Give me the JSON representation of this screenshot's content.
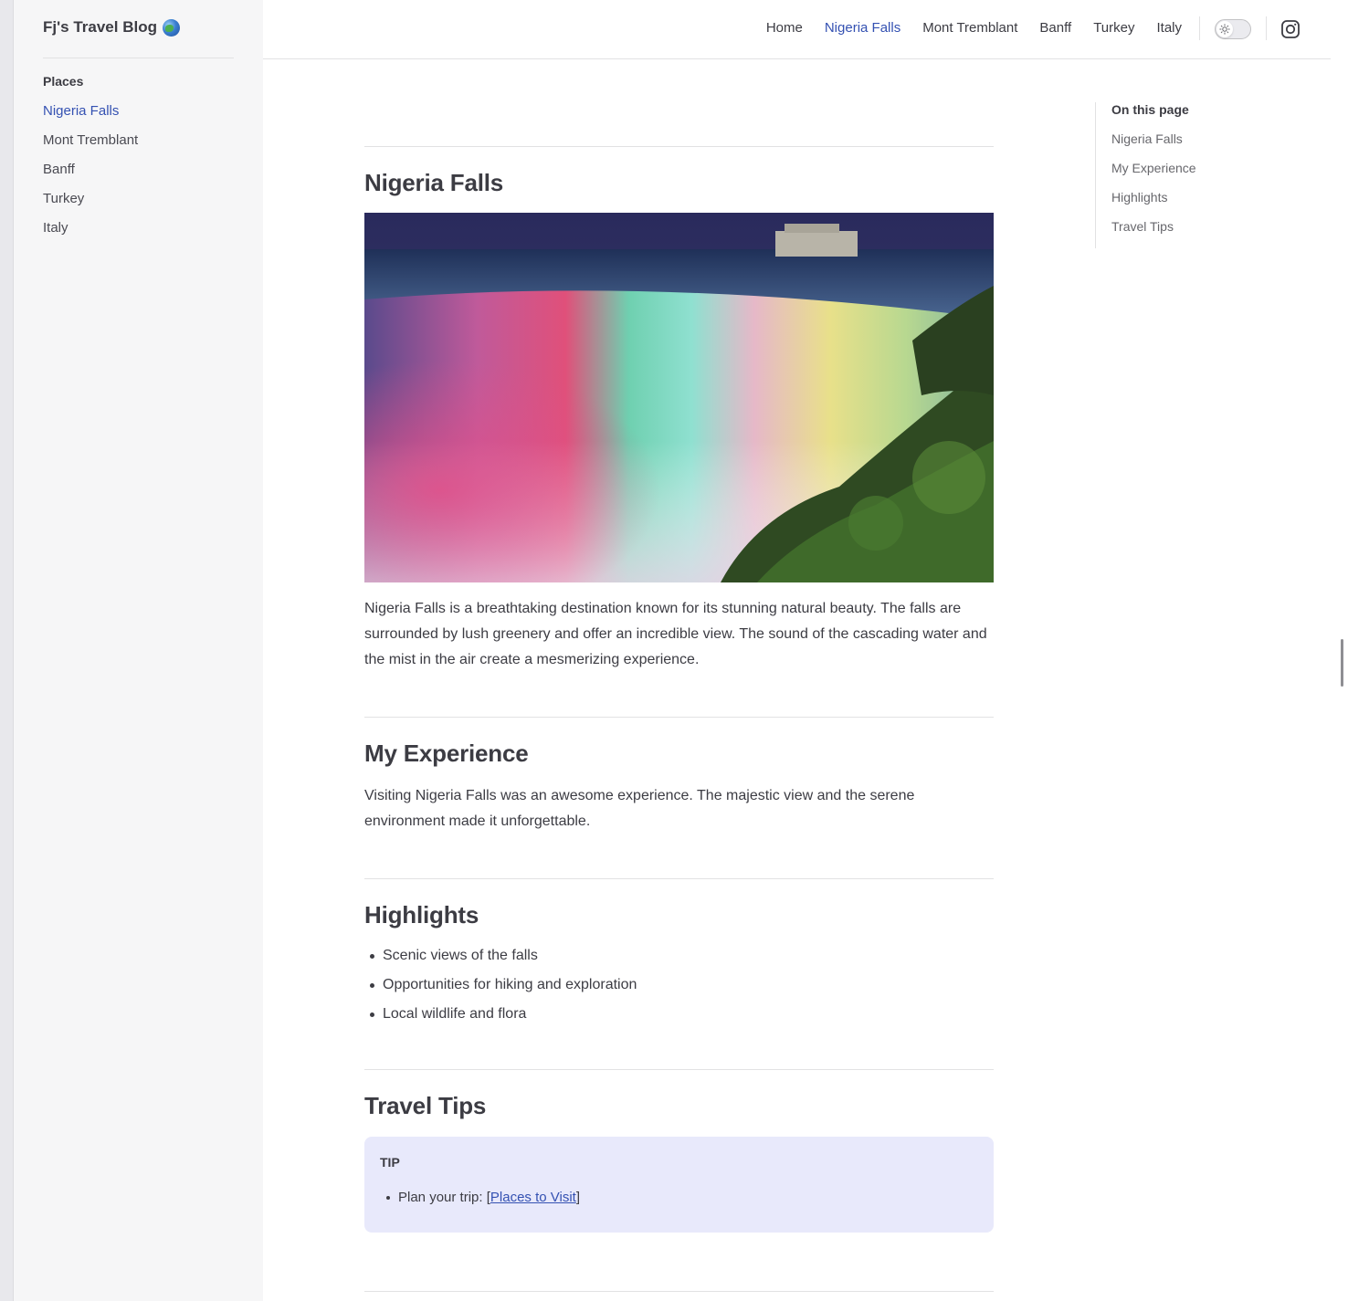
{
  "site": {
    "title": "Fj's Travel Blog"
  },
  "sidebar": {
    "section_title": "Places",
    "items": [
      {
        "label": "Nigeria Falls",
        "active": true
      },
      {
        "label": "Mont Tremblant",
        "active": false
      },
      {
        "label": "Banff",
        "active": false
      },
      {
        "label": "Turkey",
        "active": false
      },
      {
        "label": "Italy",
        "active": false
      }
    ]
  },
  "topnav": {
    "items": [
      {
        "label": "Home"
      },
      {
        "label": "Nigeria Falls"
      },
      {
        "label": "Mont Tremblant"
      },
      {
        "label": "Banff"
      },
      {
        "label": "Turkey"
      },
      {
        "label": "Italy"
      }
    ],
    "active_index": 1,
    "theme_toggle_icon": "sun-icon",
    "social_icon": "instagram-icon"
  },
  "article": {
    "sections": [
      {
        "heading": "Nigeria Falls",
        "body": "Nigeria Falls is a breathtaking destination known for its stunning natural beauty. The falls are surrounded by lush greenery and offer an incredible view. The sound of the cascading water and the mist in the air create a mesmerizing experience."
      },
      {
        "heading": "My Experience",
        "body": "Visiting Nigeria Falls was an awesome experience. The majestic view and the serene environment made it unforgettable."
      },
      {
        "heading": "Highlights",
        "bullets": [
          "Scenic views of the falls",
          "Opportunities for hiking and exploration",
          "Local wildlife and flora"
        ]
      },
      {
        "heading": "Travel Tips",
        "tip": {
          "title": "TIP",
          "item_prefix": "Plan your trip: [",
          "link_text": "Places to Visit",
          "item_suffix": "]"
        }
      }
    ]
  },
  "toc": {
    "title": "On this page",
    "items": [
      "Nigeria Falls",
      "My Experience",
      "Highlights",
      "Travel Tips"
    ]
  },
  "colors": {
    "accent": "#3451b2",
    "tip_background": "#e8e9fb",
    "sidebar_background": "#f6f6f7"
  }
}
